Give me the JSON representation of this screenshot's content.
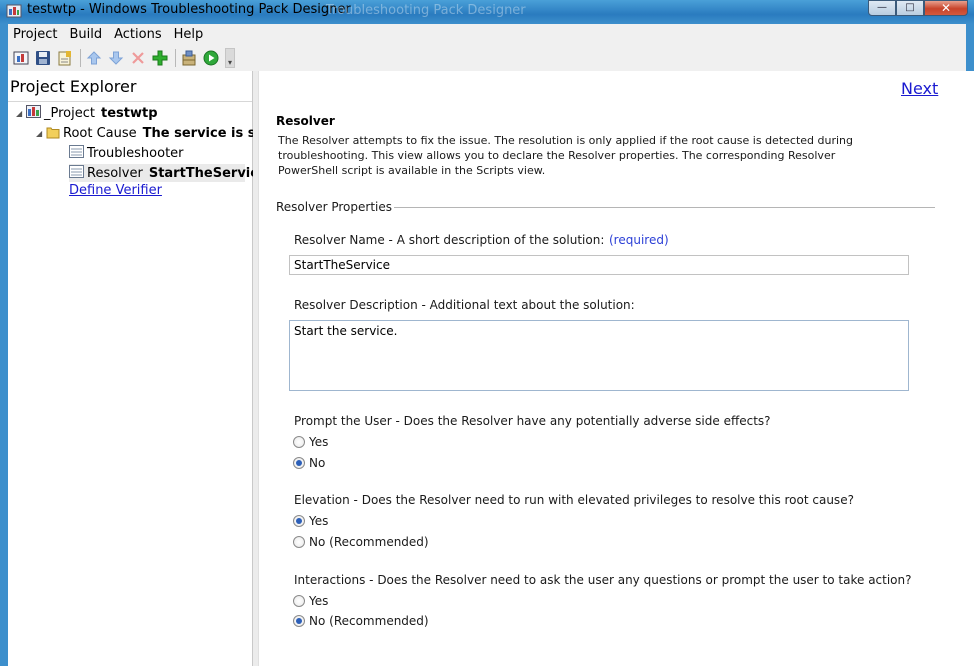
{
  "window": {
    "title": "testwtp - Windows Troubleshooting Pack Designer",
    "ghost_title": "Troubleshooting Pack Designer",
    "minimize_glyph": "—",
    "maximize_glyph": "□",
    "close_glyph": "✕"
  },
  "menu": {
    "items": [
      "Project",
      "Build",
      "Actions",
      "Help"
    ]
  },
  "toolbar": {
    "icons": [
      "new-project-icon",
      "save-icon",
      "open-project-icon",
      "move-up-icon",
      "move-down-icon",
      "delete-icon",
      "add-icon",
      "build-icon",
      "run-icon"
    ],
    "overflow": "▾"
  },
  "project_explorer": {
    "title": "Project Explorer",
    "tree": [
      {
        "arrow": "◢",
        "label": "_Project",
        "value": "testwtp"
      },
      {
        "arrow": "◢",
        "label": "Root Cause",
        "value": "The service is stop"
      },
      {
        "arrow": "",
        "label": "Troubleshooter",
        "value": ""
      },
      {
        "arrow": "",
        "label": "Resolver",
        "value": "StartTheService"
      }
    ],
    "define_verifier": "Define Verifier"
  },
  "resolver": {
    "next": "Next",
    "title": "Resolver",
    "description": "The Resolver attempts to fix the issue. The resolution is only applied if the root cause is detected during troubleshooting. This view allows you to declare the Resolver properties. The corresponding Resolver PowerShell script is available in the Scripts view.",
    "group_label": "Resolver Properties",
    "name_label": "Resolver Name - A short description of the solution:",
    "required": "(required)",
    "name_value": "StartTheService",
    "desc_label": "Resolver Description - Additional text about the solution:",
    "desc_value": "Start the service.",
    "prompt": {
      "label": "Prompt the User - Does the Resolver have any potentially adverse side effects?",
      "options": [
        "Yes",
        "No"
      ],
      "selected": "No"
    },
    "elevation": {
      "label": "Elevation - Does the Resolver need to run with elevated privileges to resolve this root cause?",
      "options": [
        "Yes",
        "No (Recommended)"
      ],
      "selected": "Yes"
    },
    "interactions": {
      "label": "Interactions - Does the Resolver need to ask the user any questions or prompt the user to take action?",
      "options": [
        "Yes",
        "No (Recommended)"
      ],
      "selected": "No (Recommended)"
    }
  },
  "colors": {
    "accent": "#3d8fcc",
    "link": "#1a1ad0",
    "required": "#2b3fd6",
    "radio_dot": "#2c5fb8"
  }
}
